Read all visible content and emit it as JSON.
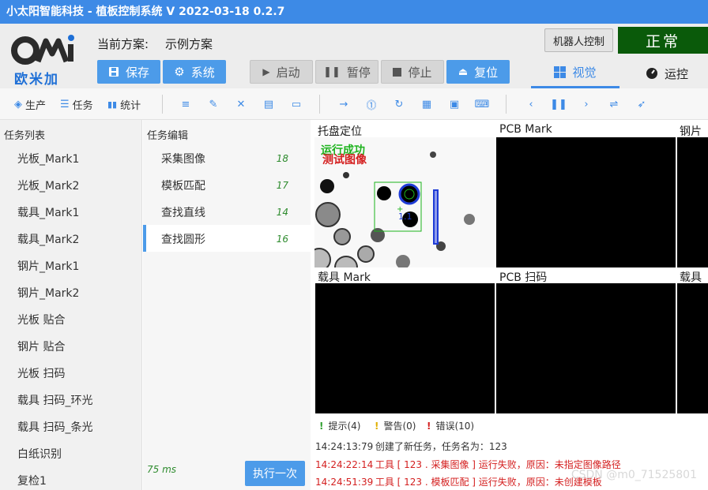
{
  "window": {
    "title": "小太阳智能科技 - 植板控制系统  V 2022-03-18 0.2.7"
  },
  "header": {
    "logo_text": "欧米加",
    "logo_mark": "OMI",
    "scheme_label": "当前方案:",
    "scheme_value": "示例方案",
    "buttons": {
      "save": "保存",
      "system": "系统",
      "start": "启动",
      "pause": "暂停",
      "stop": "停止",
      "reset": "复位"
    },
    "robot_control": "机器人控制",
    "status": "正常",
    "tabs": {
      "vision": "视觉",
      "operation": "运控"
    }
  },
  "toolbar": {
    "production": "生产",
    "task": "任务",
    "stats": "统计"
  },
  "task_list": {
    "title": "任务列表",
    "items": [
      "光板_Mark1",
      "光板_Mark2",
      "载具_Mark1",
      "载具_Mark2",
      "钢片_Mark1",
      "钢片_Mark2",
      "光板 贴合",
      "钢片 贴合",
      "光板 扫码",
      "载具 扫码_环光",
      "载具 扫码_条光",
      "白纸识别",
      "复检1"
    ]
  },
  "task_editor": {
    "title": "任务编辑",
    "items": [
      {
        "label": "采集图像",
        "count": "18"
      },
      {
        "label": "模板匹配",
        "count": "17"
      },
      {
        "label": "查找直线",
        "count": "14"
      },
      {
        "label": "查找圆形",
        "count": "16"
      }
    ],
    "timing": "75 ms",
    "run_once": "执行一次"
  },
  "vision": {
    "cells": {
      "c1": "托盘定位",
      "c2": "PCB Mark",
      "c3": "钢片 I",
      "c4": "载具 Mark",
      "c5": "PCB 扫码",
      "c6": "载具 扫"
    },
    "overlay": {
      "success": "运行成功",
      "test": "测试图像",
      "label": "1.1"
    }
  },
  "log": {
    "tabs": {
      "info": "提示(4)",
      "warn": "警告(0)",
      "error": "错误(10)"
    },
    "lines": [
      {
        "time": "14:24:13:79",
        "text": "创建了新任务，任务名为：123",
        "color": "#333333"
      },
      {
        "time": "14:24:22:14",
        "text": "工具 [ 123 . 采集图像 ] 运行失败，原因：未指定图像路径",
        "color": "#d42020"
      },
      {
        "time": "14:24:51:39",
        "text": "工具 [ 123 . 模板匹配 ] 运行失败，原因：未创建模板",
        "color": "#d42020"
      }
    ],
    "watermark": "CSDN @m0_71525801"
  }
}
